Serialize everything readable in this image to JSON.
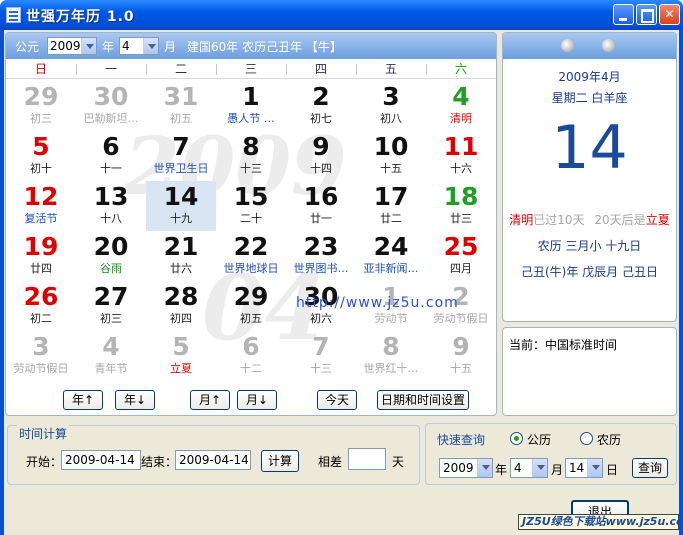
{
  "window": {
    "title": "世强万年历 1.0"
  },
  "header": {
    "gongli_label": "公元",
    "year_value": "2009",
    "year_unit": "年",
    "month_value": "4",
    "month_unit": "月",
    "info": "建国60年 农历己丑年 【牛】"
  },
  "weekdays": [
    "日",
    "一",
    "二",
    "三",
    "四",
    "五",
    "六"
  ],
  "watermark": {
    "year": "2009",
    "month": "04"
  },
  "calendar": [
    [
      {
        "n": "29",
        "s": "初三",
        "c": "gray"
      },
      {
        "n": "30",
        "s": "巴勒斯坦…",
        "c": "gray"
      },
      {
        "n": "31",
        "s": "初五",
        "c": "gray"
      },
      {
        "n": "1",
        "s": "愚人节 …",
        "c": "",
        "sc": "blue"
      },
      {
        "n": "2",
        "s": "初七",
        "c": ""
      },
      {
        "n": "3",
        "s": "初八",
        "c": ""
      },
      {
        "n": "4",
        "s": "清明",
        "c": "green",
        "sc": "red"
      }
    ],
    [
      {
        "n": "5",
        "s": "初十",
        "c": "red"
      },
      {
        "n": "6",
        "s": "十一",
        "c": ""
      },
      {
        "n": "7",
        "s": "世界卫生日",
        "c": "",
        "sc": "blue"
      },
      {
        "n": "8",
        "s": "十三",
        "c": ""
      },
      {
        "n": "9",
        "s": "十四",
        "c": ""
      },
      {
        "n": "10",
        "s": "十五",
        "c": ""
      },
      {
        "n": "11",
        "s": "十六",
        "c": "red"
      }
    ],
    [
      {
        "n": "12",
        "s": "复活节",
        "c": "red",
        "sc": "blue"
      },
      {
        "n": "13",
        "s": "十八",
        "c": ""
      },
      {
        "n": "14",
        "s": "十九",
        "c": "",
        "today": true
      },
      {
        "n": "15",
        "s": "二十",
        "c": ""
      },
      {
        "n": "16",
        "s": "廿一",
        "c": ""
      },
      {
        "n": "17",
        "s": "廿二",
        "c": ""
      },
      {
        "n": "18",
        "s": "廿三",
        "c": "green"
      }
    ],
    [
      {
        "n": "19",
        "s": "廿四",
        "c": "red"
      },
      {
        "n": "20",
        "s": "谷雨",
        "c": "",
        "sc": "green"
      },
      {
        "n": "21",
        "s": "廿六",
        "c": ""
      },
      {
        "n": "22",
        "s": "世界地球日",
        "c": "",
        "sc": "blue"
      },
      {
        "n": "23",
        "s": "世界图书…",
        "c": "",
        "sc": "blue"
      },
      {
        "n": "24",
        "s": "亚非新闻…",
        "c": "",
        "sc": "blue"
      },
      {
        "n": "25",
        "s": "四月",
        "c": "red"
      }
    ],
    [
      {
        "n": "26",
        "s": "初二",
        "c": "red"
      },
      {
        "n": "27",
        "s": "初三",
        "c": ""
      },
      {
        "n": "28",
        "s": "初四",
        "c": ""
      },
      {
        "n": "29",
        "s": "初五",
        "c": ""
      },
      {
        "n": "30",
        "s": "初六",
        "c": ""
      },
      {
        "n": "1",
        "s": "劳动节",
        "c": "gray"
      },
      {
        "n": "2",
        "s": "劳动节假日",
        "c": "gray"
      }
    ],
    [
      {
        "n": "3",
        "s": "劳动节假日",
        "c": "gray"
      },
      {
        "n": "4",
        "s": "青年节",
        "c": "gray"
      },
      {
        "n": "5",
        "s": "立夏",
        "c": "gray",
        "sc": "red"
      },
      {
        "n": "6",
        "s": "十二",
        "c": "gray"
      },
      {
        "n": "7",
        "s": "十三",
        "c": "gray"
      },
      {
        "n": "8",
        "s": "世界红十…",
        "c": "gray"
      },
      {
        "n": "9",
        "s": "十五",
        "c": "gray"
      }
    ]
  ],
  "url_overlay": "http://www.jz5u.com",
  "nav_buttons": {
    "year_up": "年↑",
    "year_down": "年↓",
    "month_up": "月↑",
    "month_down": "月↓",
    "today": "今天",
    "set_datetime": "日期和时间设置"
  },
  "info": {
    "year_month": "2009年4月",
    "weekday_star": "星期二  白羊座",
    "day": "14",
    "solar_term_name": "清明",
    "solar_term_past": "已过10天",
    "solar_term_next_text": "20天后是",
    "solar_term_next_name": "立夏",
    "lunar_line": "农历   三月小 十九日",
    "ganzhi_line": "己丑(牛)年  戊辰月  己丑日"
  },
  "current": {
    "label": "当前：中国标准时间"
  },
  "time_calc": {
    "title": "时间计算",
    "start_label": "开始：",
    "start_value": "2009-04-14",
    "end_label": "结束：",
    "end_value": "2009-04-14",
    "calc_button": "计算",
    "diff_label": "相差",
    "diff_value": "",
    "diff_unit": "天"
  },
  "quick_query": {
    "title": "快速查询",
    "radio_gongli": "公历",
    "radio_nongli": "农历",
    "year": "2009",
    "year_unit": "年",
    "month": "4",
    "month_unit": "月",
    "day": "14",
    "day_unit": "日",
    "query_button": "查询"
  },
  "exit_button": "退出",
  "badge": "JZ5U绿色下载站www.jz5u.com",
  "colors": {
    "title_blue": "#0058e6",
    "red": "#e00000",
    "green": "#20a020",
    "navy": "#1a4a9a"
  }
}
